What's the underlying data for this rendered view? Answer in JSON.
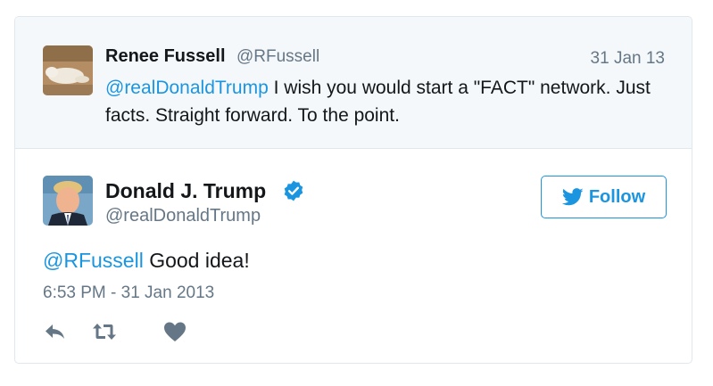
{
  "parent_tweet": {
    "avatar_icon": "dog-photo-avatar",
    "name": "Renee Fussell",
    "handle": "@RFussell",
    "date": "31 Jan 13",
    "mention": "@realDonaldTrump",
    "text": " I wish you would start a \"FACT\" network. Just facts. Straight forward. To the point."
  },
  "main_tweet": {
    "avatar_icon": "portrait-avatar",
    "name": "Donald J. Trump",
    "verified_icon": "verified-badge-icon",
    "handle": "@realDonaldTrump",
    "follow_label": "Follow",
    "mention": "@RFussell",
    "text": " Good idea!",
    "timestamp": "6:53 PM - 31 Jan 2013"
  },
  "actions": [
    {
      "icon": "reply-icon"
    },
    {
      "icon": "retweet-icon"
    },
    {
      "icon": "like-heart-icon"
    }
  ],
  "colors": {
    "link": "#1b95e0",
    "text": "#14171a",
    "muted": "#657786",
    "parent_bg": "#f5f8fa",
    "border": "#e1e8ed"
  }
}
